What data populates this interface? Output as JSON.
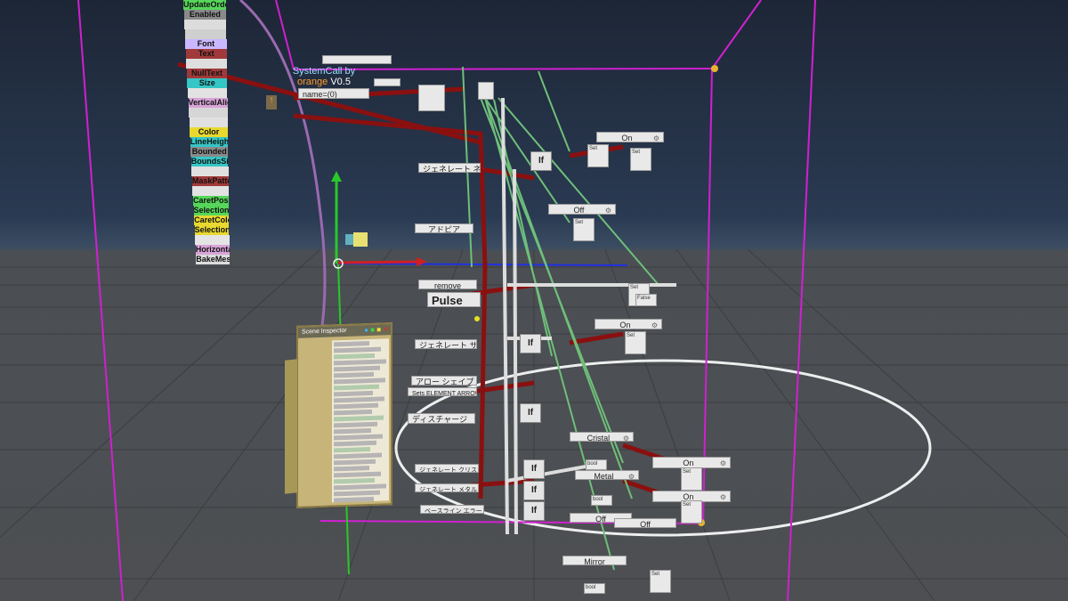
{
  "title": {
    "line1": "SystemCall by",
    "line2": "orange",
    "version": "V0.5"
  },
  "component_list": [
    {
      "label": "UpdateOrder",
      "color": "#56d65a"
    },
    {
      "label": "Enabled",
      "color": "#8a8a8a"
    },
    {
      "label": "",
      "color": "#dcdcdc"
    },
    {
      "label": "",
      "color": "#cfcfcf"
    },
    {
      "label": "Font",
      "color": "#c9b8ff"
    },
    {
      "label": "Text",
      "color": "#a03a3a"
    },
    {
      "label": "",
      "color": "#dedede"
    },
    {
      "label": "NullText",
      "color": "#a03a3a"
    },
    {
      "label": "Size",
      "color": "#35c6c6"
    },
    {
      "label": "",
      "color": "#e2e2e2"
    },
    {
      "label": "VerticalAlign",
      "color": "#d8a4d8"
    },
    {
      "label": "",
      "color": "#d6d6d6"
    },
    {
      "label": "",
      "color": "#e0e0e0"
    },
    {
      "label": "Color",
      "color": "#e8d830"
    },
    {
      "label": "LineHeight",
      "color": "#35c6c6"
    },
    {
      "label": "Bounded",
      "color": "#8a8a8a"
    },
    {
      "label": "BoundsSize",
      "color": "#35c6c6"
    },
    {
      "label": "",
      "color": "#e0e0e0"
    },
    {
      "label": "MaskPattern",
      "color": "#a03a3a"
    },
    {
      "label": "",
      "color": "#e2e2e2"
    },
    {
      "label": "CaretPosition",
      "color": "#56d65a"
    },
    {
      "label": "SelectionStart",
      "color": "#56d65a"
    },
    {
      "label": "CaretColor",
      "color": "#e8d830"
    },
    {
      "label": "SelectionColor",
      "color": "#e8d830"
    },
    {
      "label": "",
      "color": "#e4e4e4"
    },
    {
      "label": "HorizontalAlign",
      "color": "#d8a4d8"
    },
    {
      "label": "BakeMesh",
      "color": "#dcdcdc"
    }
  ],
  "nodes": {
    "name_field": "name=(0)",
    "state_on_1": "On",
    "state_off_1": "Off",
    "jp_label_1": "ジェネレート ネオン エレメント",
    "adp_label": "アドピア",
    "remove_label": "remove",
    "pulse_label": "Pulse",
    "state_on_2": "On",
    "jp_label_2": "ジェネレート サーマル エレメント",
    "arrow_shape_label": "アロー シェイプ",
    "arrow_shape_desc": "Sets ELEMENT ARROW shape",
    "discharge_label": "ディスチャージ",
    "crystal_label": "Cristal",
    "metal_label": "Metal",
    "state_on_3": "On",
    "state_on_4": "On",
    "state_off_2": "Off",
    "state_off_3": "Off",
    "mirror_label": "Mirror",
    "jp_label_3": "ジェネレート クリスタル エレメント",
    "jp_label_4": "ジェネレート メタル エレメント",
    "jp_label_5": "ベースライン エラー チェック",
    "if_label": "If",
    "bool_label": "bool",
    "false_label": "False",
    "set_label": "Set"
  },
  "inspector": {
    "title": "Scene Inspector",
    "rows": 26
  },
  "colors": {
    "sky_top": "#1d2636",
    "ground": "#4d4f52",
    "grid": "#3a3c3f",
    "magenta_box": "#d020d0",
    "axis_green": "#28c828",
    "axis_red": "#d02020",
    "axis_blue": "#2030e0",
    "wire_red": "#8a1010",
    "wire_green": "#6fbf7a",
    "wire_white": "#dddddd",
    "ring": "#ffffff"
  }
}
